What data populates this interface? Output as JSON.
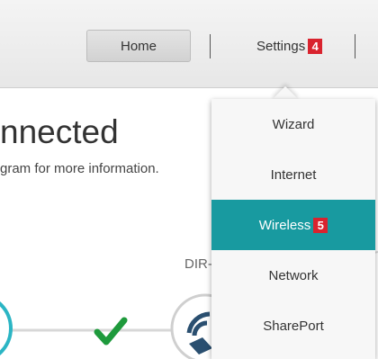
{
  "nav": {
    "home_label": "Home",
    "settings_label": "Settings",
    "settings_badge": "4"
  },
  "main": {
    "heading": "nnected",
    "subtext": "gram for more information.",
    "device_label": "DIR-"
  },
  "menu": {
    "items": [
      {
        "label": "Wizard"
      },
      {
        "label": "Internet"
      },
      {
        "label": "Wireless",
        "badge": "5",
        "active": true
      },
      {
        "label": "Network"
      },
      {
        "label": "SharePort"
      }
    ]
  },
  "colors": {
    "accent": "#189aa0",
    "badge": "#d9232e",
    "check": "#1e9a3c"
  },
  "icons": [
    "check-icon",
    "router-icon",
    "wifi-icon"
  ]
}
